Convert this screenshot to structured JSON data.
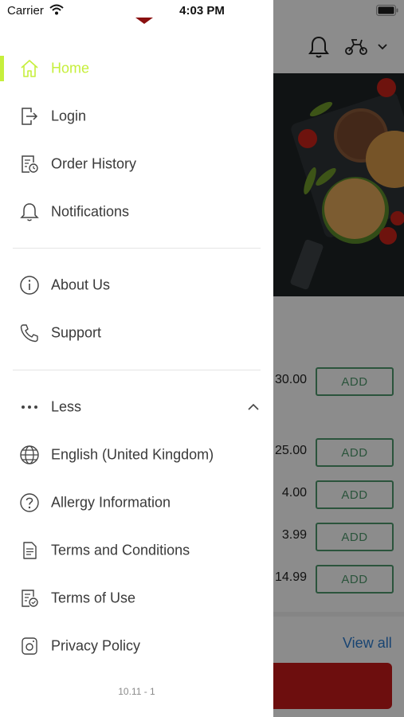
{
  "status_bar": {
    "carrier": "Carrier",
    "time": "4:03 PM"
  },
  "background": {
    "prices": [
      "30.00",
      "25.00",
      "4.00",
      "3.99",
      "14.99"
    ],
    "add_label": "ADD",
    "view_all": "View all",
    "accent_green": "#4f9a6d",
    "accent_red": "#c61a1a"
  },
  "drawer": {
    "active_color": "#c6ef3c",
    "items": [
      {
        "label": "Home",
        "icon": "home-icon"
      },
      {
        "label": "Login",
        "icon": "login-icon"
      },
      {
        "label": "Order History",
        "icon": "order-history-icon"
      },
      {
        "label": "Notifications",
        "icon": "bell-icon"
      }
    ],
    "info_items": [
      {
        "label": "About Us",
        "icon": "info-icon"
      },
      {
        "label": "Support",
        "icon": "phone-icon"
      }
    ],
    "less": {
      "label": "Less",
      "icon": "more-dots-icon"
    },
    "more_items": [
      {
        "label": "English (United Kingdom)",
        "icon": "globe-icon"
      },
      {
        "label": "Allergy Information",
        "icon": "question-icon"
      },
      {
        "label": "Terms and Conditions",
        "icon": "document-icon"
      },
      {
        "label": "Terms of Use",
        "icon": "document-check-icon"
      },
      {
        "label": "Privacy Policy",
        "icon": "privacy-icon"
      }
    ],
    "version": "10.11 - 1"
  }
}
